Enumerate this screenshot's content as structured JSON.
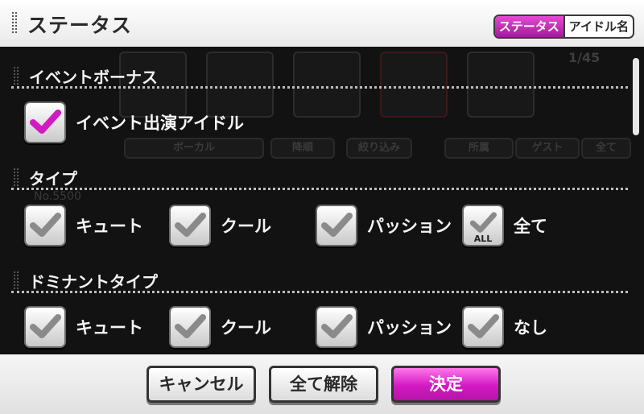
{
  "header": {
    "title": "ステータス",
    "tabs": [
      {
        "label": "ステータス",
        "active": true
      },
      {
        "label": "アイドル名",
        "active": false
      }
    ]
  },
  "background": {
    "pager": "1/45",
    "pills": [
      "ボーカル",
      "降順",
      "絞り込み",
      "所属",
      "ゲスト",
      "全て"
    ],
    "id_text": "No.5500"
  },
  "sections": {
    "event_bonus": {
      "title": "イベントボーナス",
      "items": [
        {
          "label": "イベント出演アイドル",
          "checked": true,
          "color": "#d21ac2"
        }
      ]
    },
    "type": {
      "title": "タイプ",
      "items": [
        {
          "label": "キュート",
          "checked": true
        },
        {
          "label": "クール",
          "checked": true
        },
        {
          "label": "パッション",
          "checked": true
        },
        {
          "label": "全て",
          "checked": true,
          "badge": "ALL"
        }
      ]
    },
    "dominant_type": {
      "title": "ドミナントタイプ",
      "items": [
        {
          "label": "キュート",
          "checked": true
        },
        {
          "label": "クール",
          "checked": true
        },
        {
          "label": "パッション",
          "checked": true
        },
        {
          "label": "なし",
          "checked": true
        }
      ]
    }
  },
  "footer": {
    "cancel": "キャンセル",
    "clear_all": "全て解除",
    "confirm": "決定"
  },
  "colors": {
    "accent": "#d21ac2",
    "check_gray": "#8a8a8a"
  }
}
